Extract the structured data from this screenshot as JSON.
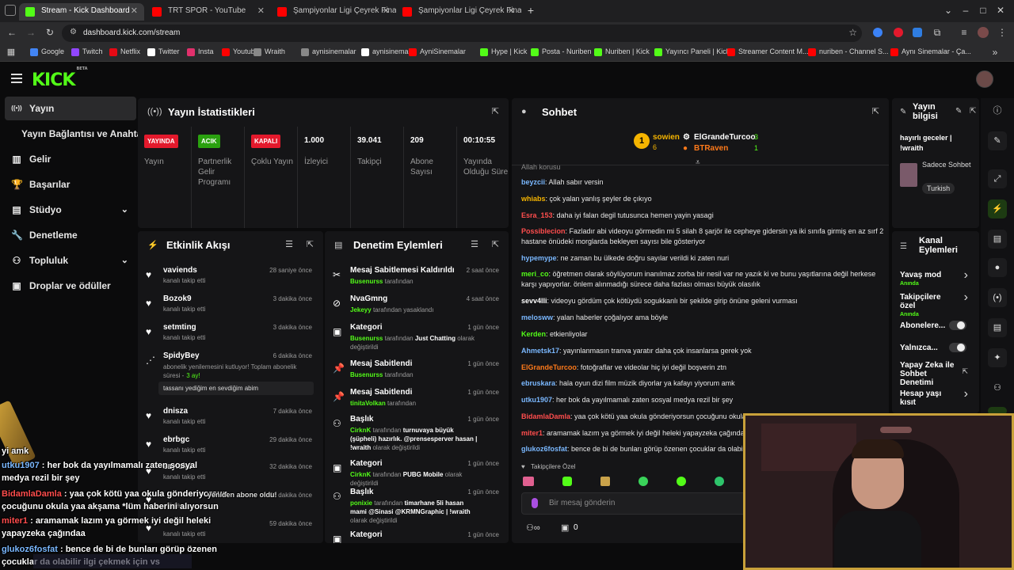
{
  "browser": {
    "tabs": [
      {
        "title": "Stream - Kick Dashboard",
        "active": true,
        "favicon_color": "#53fc18"
      },
      {
        "title": "TRT SPOR - YouTube",
        "active": false,
        "favicon_color": "#ff0000"
      },
      {
        "title": "Şampiyonlar Ligi Çeyrek Final |",
        "active": false,
        "favicon_color": "#ff0000"
      },
      {
        "title": "Şampiyonlar Ligi Çeyrek Final |",
        "active": false,
        "favicon_color": "#ff0000"
      }
    ],
    "new_tab": "+",
    "url": "dashboard.kick.com/stream",
    "bookmarks": [
      {
        "label": "Google",
        "color": "#4285f4"
      },
      {
        "label": "Twitch",
        "color": "#9146ff"
      },
      {
        "label": "Netflix",
        "color": "#e50914"
      },
      {
        "label": "Twitter",
        "color": "#ffffff"
      },
      {
        "label": "Insta",
        "color": "#e1306c"
      },
      {
        "label": "Youtube",
        "color": "#ff0000"
      },
      {
        "label": "Wraith",
        "color": "#888888"
      },
      {
        "label": "aynisinemalar",
        "color": "#888888"
      },
      {
        "label": "aynisinemalar",
        "color": "#ffffff"
      },
      {
        "label": "AyniSinemalar",
        "color": "#ff0000"
      },
      {
        "label": "Hype | Kick",
        "color": "#53fc18"
      },
      {
        "label": "Posta - Nuriben",
        "color": "#53fc18"
      },
      {
        "label": "Nuriben | Kick",
        "color": "#53fc18"
      },
      {
        "label": "Yayıncı Paneli | Kick",
        "color": "#53fc18"
      },
      {
        "label": "Streamer Content M...",
        "color": "#ff0000"
      },
      {
        "label": "nuriben - Channel S...",
        "color": "#ff0000"
      },
      {
        "label": "Aynı Sinemalar - Ça...",
        "color": "#ff0000"
      }
    ]
  },
  "kick": {
    "logo": "KICK",
    "logo_sup": "BETA"
  },
  "sidebar": {
    "items": [
      {
        "label": "Yayın",
        "icon": "broadcast-icon",
        "active": true,
        "chevron": false
      },
      {
        "label": "Yayın Bağlantısı ve Anahtarı",
        "icon": "",
        "active": false,
        "chevron": false
      },
      {
        "label": "Gelir",
        "icon": "money-icon",
        "active": false,
        "chevron": false
      },
      {
        "label": "Başarılar",
        "icon": "trophy-icon",
        "active": false,
        "chevron": false
      },
      {
        "label": "Stüdyo",
        "icon": "studio-icon",
        "active": false,
        "chevron": true
      },
      {
        "label": "Denetleme",
        "icon": "wrench-icon",
        "active": false,
        "chevron": false
      },
      {
        "label": "Topluluk",
        "icon": "community-icon",
        "active": false,
        "chevron": true
      },
      {
        "label": "Droplar ve ödüller",
        "icon": "gift-icon",
        "active": false,
        "chevron": false
      }
    ]
  },
  "stats": {
    "title": "Yayın İstatistikleri",
    "cells": [
      {
        "badge": "YAYINDA",
        "badge_color": "#e3192c",
        "label": "Yayın"
      },
      {
        "badge": "ACIK",
        "badge_color": "#2aa10f",
        "label": "Partnerlik Gelir Programı"
      },
      {
        "badge": "KAPALI",
        "badge_color": "#e3192c",
        "label": "Çoklu Yayın"
      },
      {
        "value": "1.000",
        "label": "İzleyici"
      },
      {
        "value": "39.041",
        "label": "Takipçi"
      },
      {
        "value": "209",
        "label": "Abone Sayısı"
      },
      {
        "value": "00:10:55",
        "label": "Yayında Olduğu Süre"
      }
    ]
  },
  "activity": {
    "title": "Etkinlik Akışı",
    "items": [
      {
        "name": "vaviends",
        "sub": "kanalı takip etti",
        "time": "28 saniye önce"
      },
      {
        "name": "Bozok9",
        "sub": "kanalı takip etti",
        "time": "3 dakika önce"
      },
      {
        "name": "setmting",
        "sub": "kanalı takip etti",
        "time": "3 dakika önce"
      },
      {
        "name": "SpidyBey",
        "sub": "abonelik yenilemesini kutluyor! Toplam abonelik süresi -",
        "sub_highlight": "3 ay!",
        "quote": "tassanı yediğim en sevdiğim abim",
        "time": "6 dakika önce"
      },
      {
        "name": "dnisza",
        "sub": "kanalı takip etti",
        "time": "7 dakika önce"
      },
      {
        "name": "ebrbgc",
        "sub": "kanalı takip etti",
        "time": "29 dakika önce"
      },
      {
        "name": "zayiaiai",
        "sub": "kanalı takip etti",
        "time": "32 dakika önce"
      },
      {
        "name": "",
        "sub": "oldular",
        "time": "51 dakika önce"
      },
      {
        "name": "",
        "sub": "kanalı takip etti",
        "time": "59 dakika önce"
      }
    ]
  },
  "mod": {
    "title": "Denetim Eylemleri",
    "items": [
      {
        "title": "Mesaj Sabitlemesi Kaldırıldı",
        "user": "Busenurss",
        "rest": "tarafından",
        "time": "2 saat önce",
        "icon": "unpin-icon"
      },
      {
        "title": "NvaGmng",
        "user": "Jekeyy",
        "rest": "tarafından yasaklandı",
        "time": "4 saat önce",
        "icon": "ban-icon"
      },
      {
        "title": "Kategori",
        "user": "Busenurss",
        "rest": "tarafından",
        "user2": "Just Chatting",
        "rest2": "olarak değiştirildi",
        "time": "1 gün önce",
        "icon": "category-icon"
      },
      {
        "title": "Mesaj Sabitlendi",
        "user": "Busenurss",
        "rest": "tarafından",
        "time": "1 gün önce",
        "icon": "pin-icon"
      },
      {
        "title": "Mesaj Sabitlendi",
        "user": "tinitaVolkan",
        "rest": "tarafından",
        "time": "1 gün önce",
        "icon": "pin-icon"
      },
      {
        "title": "Başlık",
        "user": "CirknK",
        "rest": "tarafından",
        "user2": "turnuvaya büyük (şüpheli) hazırlık. @prensesperver hasan | !wraith",
        "rest2": "olarak değiştirildi",
        "time": "1 gün önce",
        "icon": "title-icon"
      },
      {
        "title": "Kategori",
        "user": "CirknK",
        "rest": "tarafından",
        "user2": "PUBG Mobile",
        "rest2": "olarak değiştirildi",
        "time": "1 gün önce",
        "icon": "category-icon"
      },
      {
        "title": "Başlık",
        "user": "ponixie",
        "rest": "tarafından",
        "user2": "timarhane 5li hasan mami @Sinasi @KRMNGraphic | !wraith",
        "rest2": "olarak değiştirildi",
        "time": "1 gün önce",
        "icon": "title-icon"
      },
      {
        "title": "Kategori",
        "user": "",
        "rest": "",
        "time": "1 gün önce",
        "icon": "category-icon"
      }
    ]
  },
  "chat": {
    "title": "Sohbet",
    "leaderboard": [
      {
        "rank": "1",
        "name": "sowien",
        "count": "6",
        "color": "#f5b400"
      },
      {
        "name": "ElGrandeTurcoo",
        "count": "3",
        "color": "#ffffff"
      },
      {
        "name": "BTRaven",
        "count": "1",
        "color": "#ff7a1a"
      }
    ],
    "cut_line": "Allah korusu",
    "messages": [
      {
        "user": "beyzcii",
        "color": "#7ab8ff",
        "text": "Allah sabır versin"
      },
      {
        "user": "whiabs",
        "color": "#f5b400",
        "text": "çok yalan yanlış şeyler de çıkıyo"
      },
      {
        "user": "Esra_153",
        "color": "#ff4d4d",
        "text": "daha iyi falan degil tutusunca hemen yayin yasagi"
      },
      {
        "user": "Possiblecion",
        "color": "#ff4d4d",
        "text": "Fazladır abi videoyu görmedin mi 5 silah 8 şarjör ile cepheye gidersin ya iki sınıfa girmiş en az sırf 2 hastane önüdeki morglarda bekleyen sayısı bile gösteriyor"
      },
      {
        "user": "hypemype",
        "color": "#7ab8ff",
        "text": "ne zaman bu ülkede doğru sayılar verildi ki zaten nuri"
      },
      {
        "user": "meri_co",
        "color": "#53fc18",
        "text": "öğretmen olarak söylüyorum inanılmaz zorba bir nesil var ne yazık ki ve bunu yaşıtlarına değil herkese karşı yapıyorlar. önlem alınmadığı sürece daha fazlası olması büyük olasılık"
      },
      {
        "user": "sevv4lli",
        "color": "#ffffff",
        "text": "videoyu gördüm çok kötüydü sogukkanlı bir şekilde girip önüne geleni vurması"
      },
      {
        "user": "melosww",
        "color": "#7ab8ff",
        "text": "yalan haberler çoğalıyor ama böyle"
      },
      {
        "user": "Kerden",
        "color": "#53fc18",
        "text": "etkienliyolar"
      },
      {
        "user": "Ahmetsk17",
        "color": "#7ab8ff",
        "text": "yayınlanmasın tranva yaratır daha çok insanlarsa gerek yok"
      },
      {
        "user": "ElGrandeTurcoo",
        "color": "#ff7a1a",
        "text": "fotoğraflar ve videolar hiç iyi değil boşverin ztn"
      },
      {
        "user": "ebruskara",
        "color": "#7ab8ff",
        "text": "hala oyun dizi film müzik diyorlar ya kafayı yiyorum amk"
      },
      {
        "user": "utku1907",
        "color": "#7ab8ff",
        "text": "her bok da yayılmamalı zaten sosyal medya rezil bir şey"
      },
      {
        "user": "BidamlaDamla",
        "color": "#ff4d4d",
        "text": "yaa çok kötü yaa okula gönderiyorsun çocuğunu okula yaa akşama *lüm haberini alıyorsun"
      },
      {
        "user": "miter1",
        "color": "#ff4d4d",
        "text": "aramamak lazım ya görmek iyi değil heleki yapayzeka çağındaa"
      },
      {
        "user": "glukoz6fosfat",
        "color": "#7ab8ff",
        "text": "bence de bi de bunları görüp özenen çocuklar da olabilir"
      }
    ],
    "followers_only": "Takipçilere Özel",
    "input_placeholder": "Bir mesaj gönderin",
    "bottom_count": "0"
  },
  "stream_info": {
    "title": "Yayın bilgisi",
    "stream_title": "hayırlı geceler | !wraith",
    "category": "Sadece Sohbet",
    "language": "Turkish"
  },
  "channel_actions": {
    "title": "Kanal Eylemleri",
    "items": [
      {
        "label": "Yavaş mod",
        "sub": "Anında",
        "type": "chevron"
      },
      {
        "label": "Takipçilere özel",
        "sub": "Anında",
        "type": "chevron"
      },
      {
        "label": "Abonelere...",
        "sub": "",
        "type": "toggle"
      },
      {
        "label": "Yalnızca...",
        "sub": "",
        "type": "toggle"
      },
      {
        "label": "Yapay Zeka ile Sohbet Denetimi",
        "sub": "",
        "type": "external"
      },
      {
        "label": "Hesap yaşı kısıt",
        "sub": "",
        "type": "chevron"
      }
    ]
  },
  "overlay": {
    "lines": [
      {
        "user": "",
        "text": "yi amk",
        "color": "#ffffff"
      },
      {
        "user": "utku1907",
        "text": ": her bok da yayılmamalı zaten sosyal",
        "color": "#7ab8ff"
      },
      {
        "user": "",
        "text": "medya rezil bir şey",
        "color": "#ffffff"
      },
      {
        "user": "BidamlaDamla",
        "text": ": yaa çok kötü yaa okula gönderiyorsun",
        "color": "#ff4d4d"
      },
      {
        "user": "",
        "text": "çocuğunu okula yaa akşama *lüm haberini alıyorsun",
        "color": "#ffffff"
      },
      {
        "user": "miter1",
        "text": ": aramamak lazım ya görmek iyi değil heleki",
        "color": "#ff4d4d"
      },
      {
        "user": "",
        "text": "yapayzeka çağındaa",
        "color": "#ffffff"
      },
      {
        "user": "glukoz6fosfat",
        "text": ": bence de bi de bunları görüp özenen",
        "color": "#7ab8ff"
      },
      {
        "user": "",
        "text": "çocuklar da olabilir ilgi çekmek için vs",
        "color": "#ffffff"
      }
    ],
    "sub_alert": "yeniden abone oldu!"
  },
  "colors": {
    "accent": "#53fc18",
    "live_red": "#e3192c",
    "panel": "#151517"
  }
}
